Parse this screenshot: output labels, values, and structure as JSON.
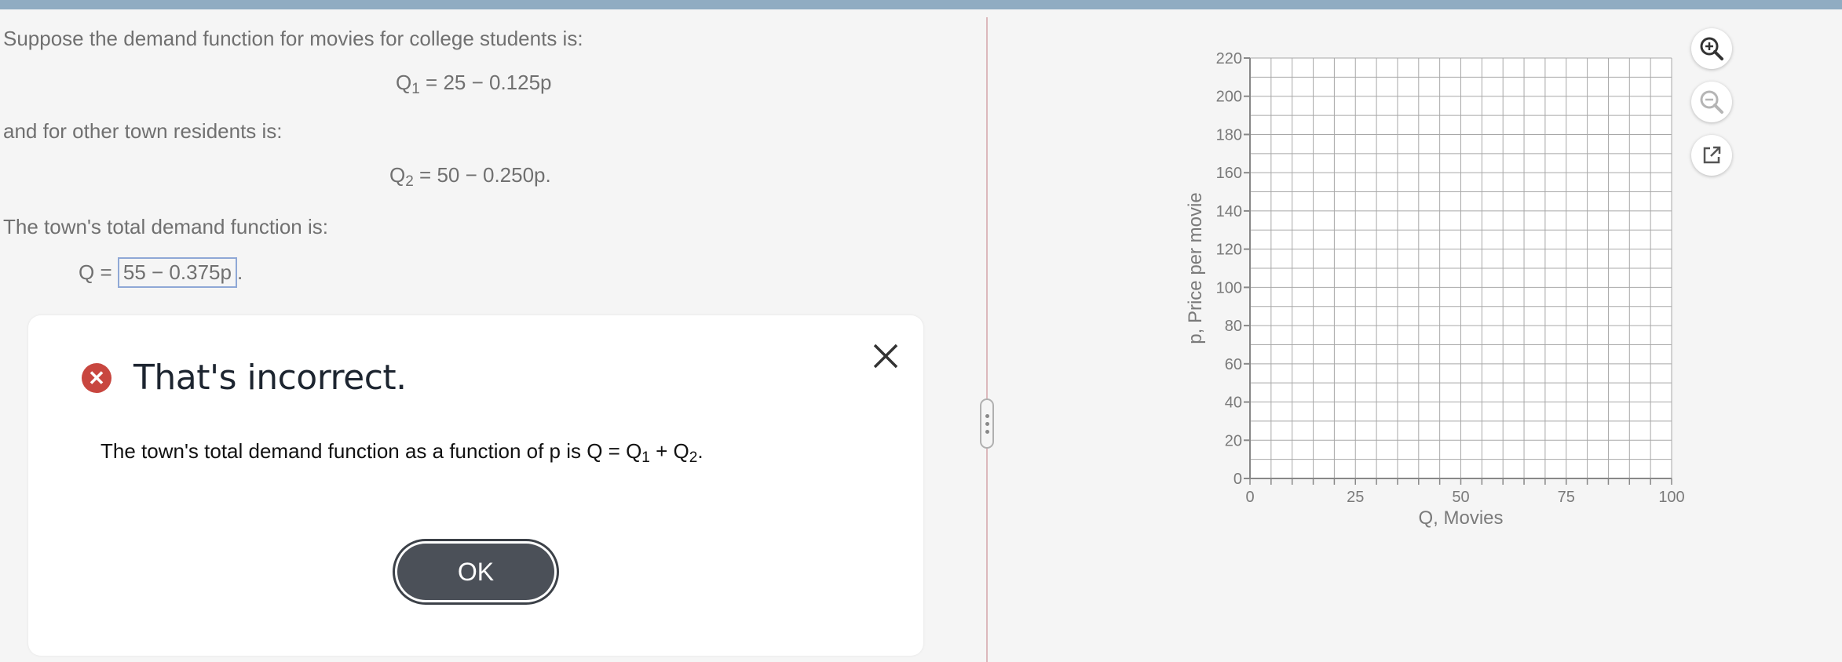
{
  "question": {
    "intro": "Suppose the demand function for movies for college students is:",
    "eq1": {
      "lhs": "Q",
      "sub": "1",
      "rhs": " = 25 − 0.125p"
    },
    "mid": "and for other town residents is:",
    "eq2": {
      "lhs": "Q",
      "sub": "2",
      "rhs": " = 50 − 0.250p."
    },
    "total_label": "The town's total demand function is:",
    "answer": {
      "prefix": "Q =",
      "value": "55 − 0.375p",
      "suffix": "."
    }
  },
  "dialog": {
    "title": "That's incorrect.",
    "message": {
      "text": "The town's total demand function as a function of p is Q = Q",
      "sub1": "1",
      "mid": " + Q",
      "sub2": "2",
      "end": "."
    },
    "ok_label": "OK",
    "icon": "error-x-icon"
  },
  "graph": {
    "x_axis_label": "Q, Movies",
    "y_axis_label": "p, Price per movie",
    "xlim": [
      0,
      100
    ],
    "ylim": [
      0,
      220
    ],
    "x_ticks": [
      "0",
      "25",
      "50",
      "75",
      "100"
    ],
    "y_ticks": [
      "0",
      "20",
      "40",
      "60",
      "80",
      "100",
      "120",
      "140",
      "160",
      "180",
      "200",
      "220"
    ],
    "grid": true
  },
  "tools": [
    "zoom-in-icon",
    "zoom-out-icon",
    "pop-out-icon"
  ],
  "colors": {
    "topbar": "#90acc2",
    "error": "#c8463f",
    "ok_button": "#4b5058",
    "answer_border": "#8fa8d6"
  }
}
